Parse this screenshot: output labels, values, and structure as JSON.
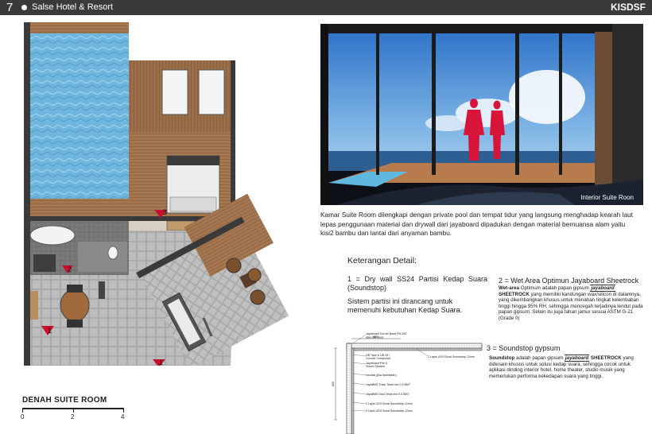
{
  "header": {
    "page_number": "7",
    "project": "Salse Hotel & Resort",
    "brand": "KISDSF"
  },
  "plan": {
    "title": "DENAH SUITE ROOM",
    "scale_labels": [
      "0",
      "2",
      "4"
    ],
    "markers": [
      "3",
      "2",
      "1",
      "1"
    ]
  },
  "photo": {
    "caption": "Interior Suite Roon"
  },
  "description": "Kamar Suite Room dilengkapi dengan private pool dan tempat tidur yang langsung menghadap kearah laut lepas penggunaan material dan drywall dari jayaboard dipadukan dengan material bernuansa alam yaitu kisi2 bambu dan lantai dari anyaman bambu.",
  "keterangan": {
    "title": "Keterangan Detail:",
    "item1_title": "1 = Dry wall SS24 Partisi Kedap Suara (Soundstop)",
    "item1_text": "Sistem partisi ini dirancang untuk memenuhi kebutuhan Kedap Suara.",
    "item2_title": "2 = Wet Area Optimun Jayaboard Sheetrock",
    "item2_lead": "Wet-area",
    "item2_a": " Optimum adalah papan gipsum ",
    "item2_brand": "jayaboard",
    "item2_b": " SHEETROCK",
    "item2_c": " yang memiliki kandungan wax/silicon di dalamnya, yang dikembangkan khusus untuk menahan tingkat kelembaban tinggi hingga 95% RH, sehingga mencegah terjadinya lendut pada papan gipsum. Selain itu juga tahan jamur sesuai ASTM G-21 (Grade 0)",
    "item3_title": "3 = Soundstop gypsum",
    "item3_lead": "Soundstop",
    "item3_a": " adalah papan gipsum ",
    "item3_brand": "jayaboard",
    "item3_b": " SHEETROCK",
    "item3_c": " yang didesain khusus untuk solusi kedap suara, sehingga cocok untuk aplikasi dinding interior hotel, home theater, studio musik yang memerlukan performa kekedapan suara yang tinggi."
  },
  "detail_labels": {
    "l1": "Jayaboard Corner Bead PN-300",
    "l2": "atau UB Steel",
    "dim": "600",
    "l3": "UB Tape & UB 25 /",
    "l4": "Cornice Compound",
    "l5": "Jayaboard Fire &",
    "l6": "Sound Sealant",
    "l7": "Insulasi (jika diperlukan)",
    "l8": "JayaBMS Track Tebal min 0.5 BMT",
    "l9": "JayaBMS Stud Tebal min 0.5 BMT",
    "l10": "2 Lapis USG Boral Soundstop 12mm",
    "l11": "2 Lapis USG Boral Soundstop 12mm",
    "r1": "2 Lapis USG Boral Soundstop 12mm",
    "height": "600"
  }
}
